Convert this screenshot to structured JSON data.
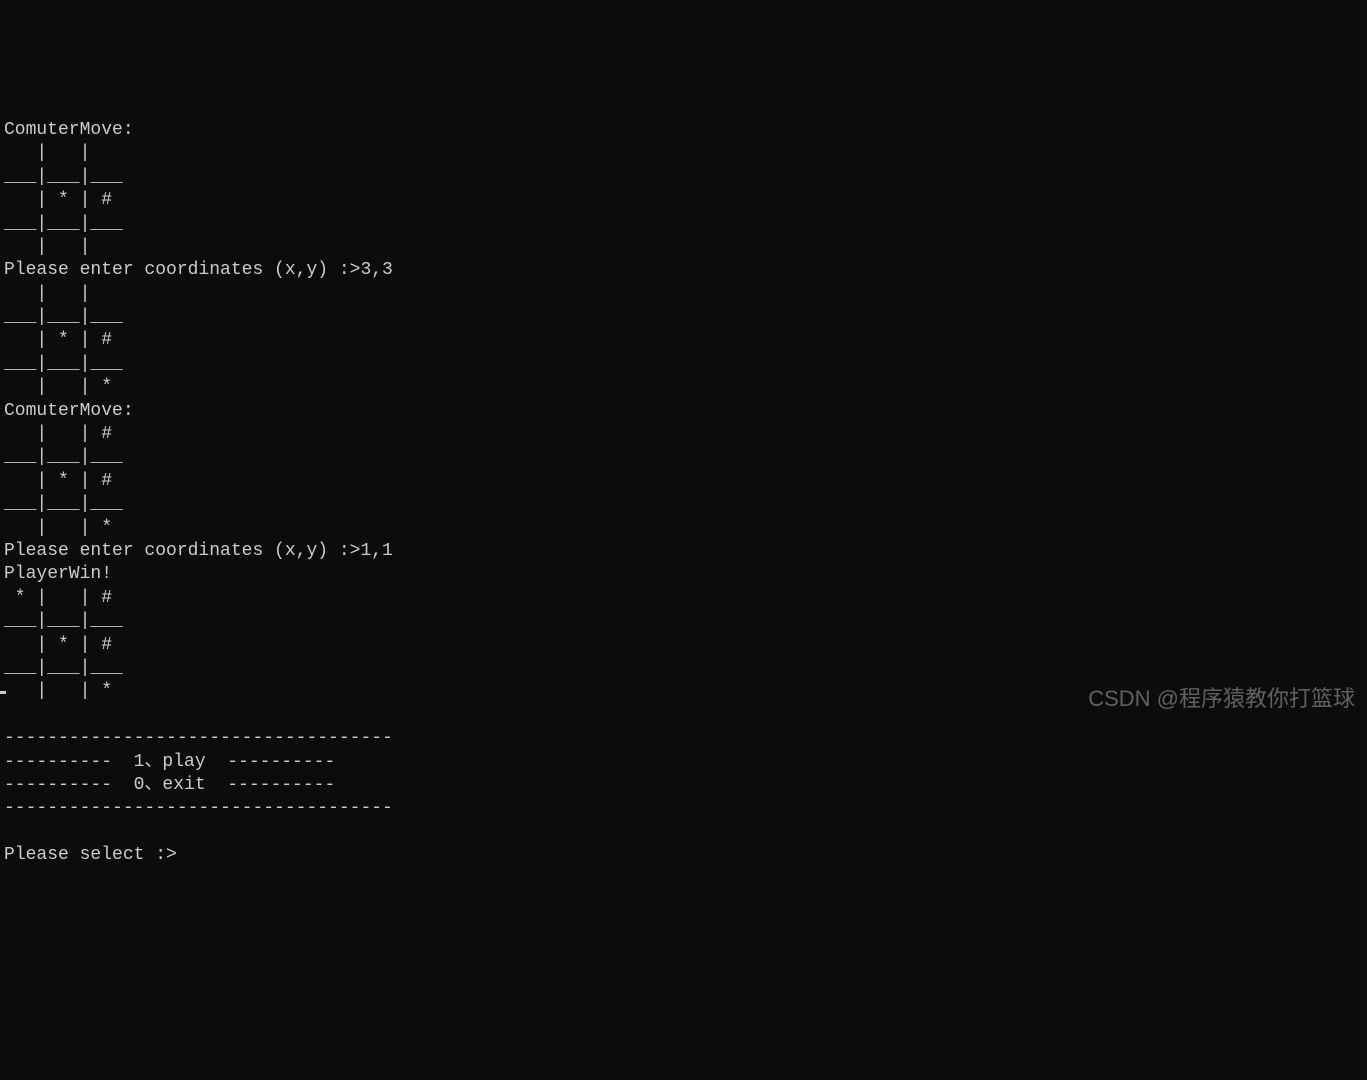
{
  "terminal": {
    "lines": [
      "ComuterMove:",
      "   |   |   ",
      "___|___|___",
      "   | * | # ",
      "___|___|___",
      "   |   |   ",
      "Please enter coordinates (x,y) :>3,3",
      "   |   |   ",
      "___|___|___",
      "   | * | # ",
      "___|___|___",
      "   |   | * ",
      "ComuterMove:",
      "   |   | # ",
      "___|___|___",
      "   | * | # ",
      "___|___|___",
      "   |   | * ",
      "Please enter coordinates (x,y) :>1,1",
      "PlayerWin!",
      " * |   | # ",
      "___|___|___",
      "   | * | # ",
      "___|___|___",
      "   |   | * ",
      "",
      "------------------------------------",
      "----------  1、play  ----------",
      "----------  0、exit  ----------",
      "------------------------------------",
      "",
      "Please select :>"
    ]
  },
  "watermark": "CSDN @程序猿教你打篮球"
}
